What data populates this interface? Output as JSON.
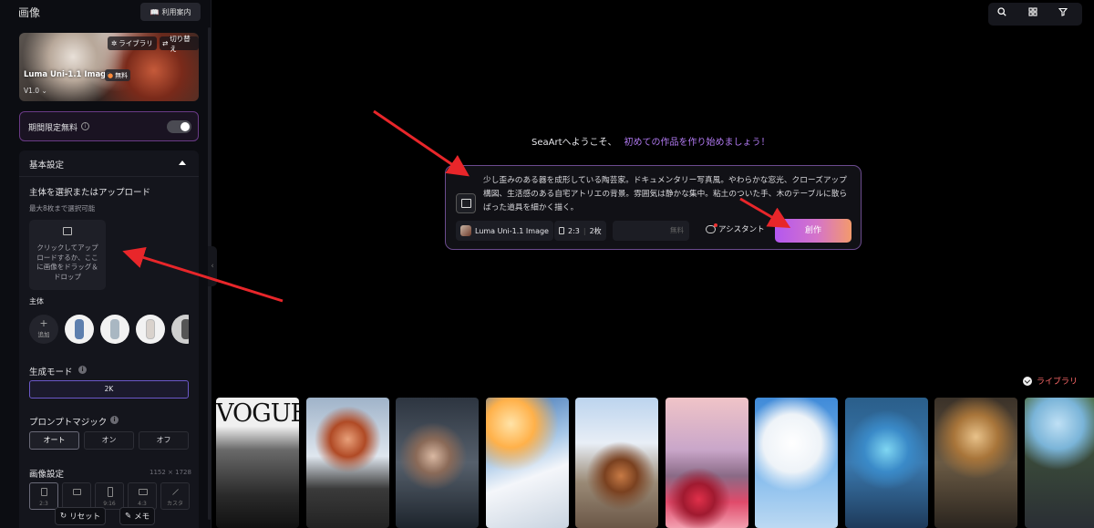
{
  "sidebar": {
    "title": "画像",
    "guide_label": "利用案内",
    "model_card": {
      "library_label": "ライブラリ",
      "switch_label": "切り替え",
      "model_name": "Luma Uni-1.1 Image",
      "free_badge": "無料",
      "version": "V1.0"
    },
    "limited_free_label": "期間限定無料",
    "basic_settings": {
      "title": "基本設定",
      "subject_upload_label": "主体を選択またはアップロード",
      "max_select": "最大8枚まで選択可能",
      "upload_text": "クリックしてアップロードするか、ここに画像をドラッグ＆ドロップ",
      "subject_label": "主体",
      "add_label": "追加",
      "generation_mode_label": "生成モード",
      "resolution": "2K",
      "prompt_magic_label": "プロンプトマジック",
      "prompt_magic_options": [
        "オート",
        "オン",
        "オフ"
      ],
      "image_settings_label": "画像設定",
      "image_size": "1152 × 1728",
      "ratios": [
        "2:3",
        "",
        "9:16",
        "4:3",
        "カスタ"
      ]
    },
    "reset_label": "リセット",
    "memo_label": "メモ"
  },
  "main": {
    "welcome_text": "SeaArtへようこそ、",
    "welcome_cta": "初めての作品を作り始めましょう！",
    "prompt_text": "少し歪みのある器を成形している陶芸家。ドキュメンタリー写真風。やわらかな窓光、クローズアップ構図、生活感のある自宅アトリエの背景。雰囲気は静かな集中。粘土のついた手、木のテーブルに散らばった道具を細かく描く。",
    "model_chip": "Luma Uni-1.1 Image",
    "ratio_chip": "2:3",
    "count_chip": "2枚",
    "free_label": "無料",
    "assistant_label": "アシスタント",
    "create_label": "創作",
    "library_link": "ライブラリ",
    "gallery_vogue_text": "VOGUE"
  },
  "colors": {
    "accent_purple": "#b079f0",
    "create_gradient_start": "#b357f0",
    "create_gradient_end": "#f39a6c",
    "library_red": "#ff6a6a",
    "annotation_arrow": "#e8262a"
  }
}
